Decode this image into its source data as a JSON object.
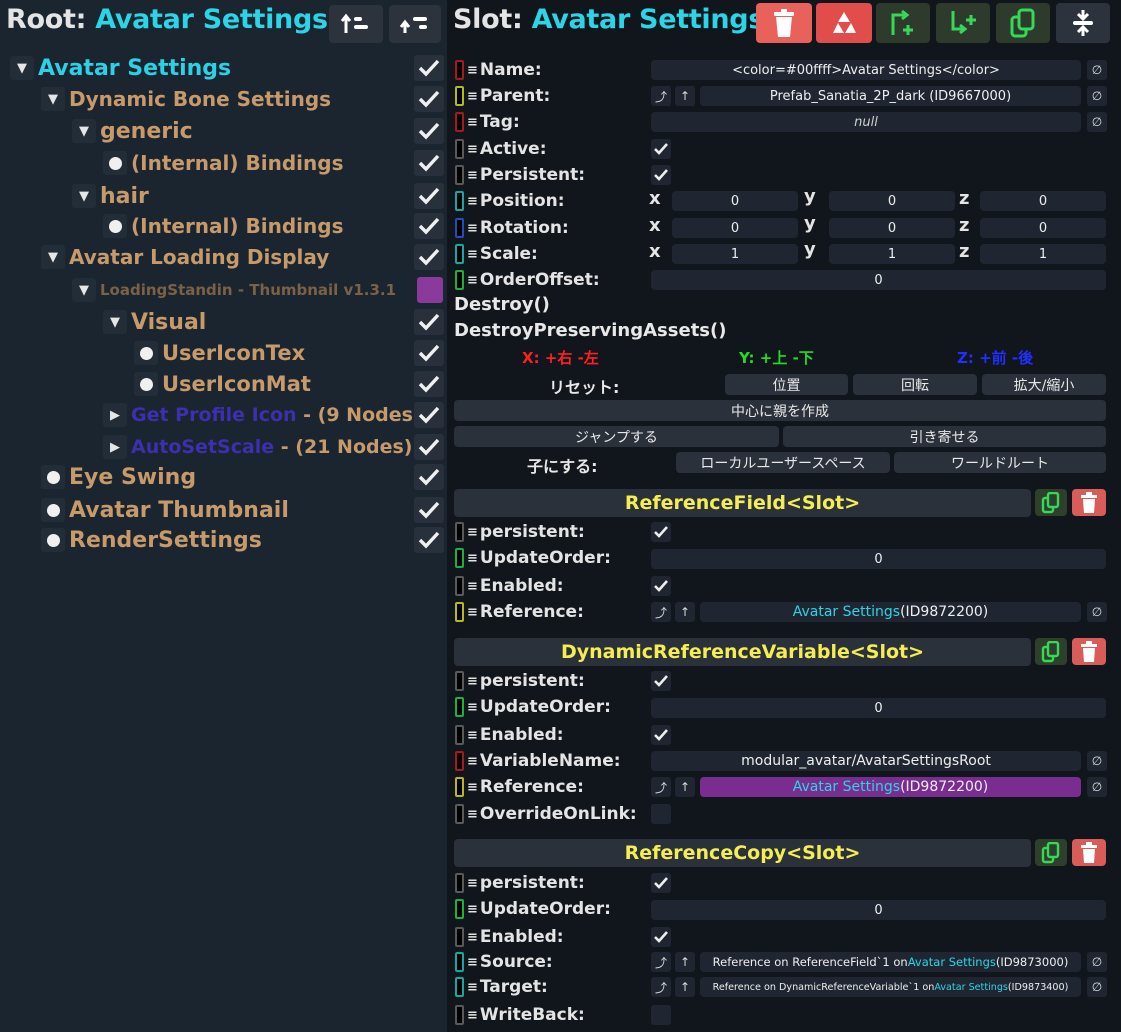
{
  "left": {
    "title_prefix": "Root: ",
    "title_name": "Avatar Settings",
    "tree": [
      {
        "label": "Avatar Settings",
        "color": "#2ed0e6",
        "marker": "tri"
      },
      {
        "label": "Dynamic Bone Settings",
        "color": "#c69a6b",
        "marker": "tri"
      },
      {
        "label": "generic",
        "color": "#c69a6b",
        "marker": "tri"
      },
      {
        "label": "(Internal) Bindings",
        "color": "#c69a6b",
        "marker": "dot"
      },
      {
        "label": "hair",
        "color": "#c69a6b",
        "marker": "tri"
      },
      {
        "label": "(Internal) Bindings",
        "color": "#c69a6b",
        "marker": "dot"
      },
      {
        "label": "Avatar Loading Display",
        "color": "#c69a6b",
        "marker": "tri"
      },
      {
        "label": "LoadingStandin - Thumbnail v1.3.1",
        "color": "#7a6148",
        "marker": "tri"
      },
      {
        "label": "Visual",
        "color": "#c69a6b",
        "marker": "tri"
      },
      {
        "label": "UserIconTex",
        "color": "#c69a6b",
        "marker": "dot"
      },
      {
        "label": "UserIconMat",
        "color": "#c69a6b",
        "marker": "dot"
      },
      {
        "label": "Get Profile Icon",
        "suffix": " - (9 Nodes)",
        "color": "#3d2fae",
        "marker": "tri-right"
      },
      {
        "label": "AutoSetScale",
        "suffix": " - (21 Nodes)",
        "color": "#3d2fae",
        "marker": "tri-right"
      },
      {
        "label": "Eye Swing",
        "color": "#c69a6b",
        "marker": "dot"
      },
      {
        "label": "Avatar Thumbnail",
        "color": "#c69a6b",
        "marker": "dot"
      },
      {
        "label": "RenderSettings",
        "color": "#c69a6b",
        "marker": "dot"
      }
    ]
  },
  "right": {
    "title_prefix": "Slot: ",
    "title_name": "Avatar Settings",
    "slot": {
      "name_label": "Name:",
      "name_value": "<color=#00ffff>Avatar Settings</color>",
      "parent_label": "Parent:",
      "parent_value": "Prefab_Sanatia_2P_dark (ID9667000)",
      "tag_label": "Tag:",
      "tag_value": "null",
      "active_label": "Active:",
      "persistent_label": "Persistent:",
      "position_label": "Position:",
      "rotation_label": "Rotation:",
      "scale_label": "Scale:",
      "orderoffset_label": "OrderOffset:",
      "orderoffset_value": "0",
      "axis_x": "x",
      "axis_y": "y",
      "axis_z": "z",
      "position": [
        "0",
        "0",
        "0"
      ],
      "rotation": [
        "0",
        "0",
        "0"
      ],
      "scale": [
        "1",
        "1",
        "1"
      ]
    },
    "destroy_label": "Destroy()",
    "destroy_preserving_label": "DestroyPreservingAssets()",
    "axis_legend": {
      "x": "X: +右 -左",
      "y": "Y: +上 -下",
      "z": "Z: +前 -後"
    },
    "reset_label": "リセット:",
    "reset_buttons": [
      "位置",
      "回転",
      "拡大/縮小"
    ],
    "create_parent_label": "中心に親を作成",
    "jump_label": "ジャンプする",
    "pull_label": "引き寄せる",
    "child_label": "子にする:",
    "child_buttons": [
      "ローカルユーザースペース",
      "ワールドルート"
    ],
    "components": [
      {
        "title": "ReferenceField<Slot>",
        "persistent_label": "persistent:",
        "updateorder_label": "UpdateOrder:",
        "updateorder_value": "0",
        "enabled_label": "Enabled:",
        "reference_label": "Reference:",
        "reference_name": "Avatar Settings",
        "reference_id": " (ID9872200)"
      },
      {
        "title": "DynamicReferenceVariable<Slot>",
        "persistent_label": "persistent:",
        "updateorder_label": "UpdateOrder:",
        "updateorder_value": "0",
        "enabled_label": "Enabled:",
        "variablename_label": "VariableName:",
        "variablename_value": "modular_avatar/AvatarSettingsRoot",
        "reference_label": "Reference:",
        "reference_name": "Avatar Settings",
        "reference_id": " (ID9872200)",
        "override_label": "OverrideOnLink:"
      },
      {
        "title": "ReferenceCopy<Slot>",
        "persistent_label": "persistent:",
        "updateorder_label": "UpdateOrder:",
        "updateorder_value": "0",
        "enabled_label": "Enabled:",
        "source_label": "Source:",
        "source_pre": "Reference on ReferenceField`1 on ",
        "source_name": "Avatar Settings",
        "source_id": " (ID9873000)",
        "target_label": "Target:",
        "target_pre": "Reference on DynamicReferenceVariable`1 on ",
        "target_name": "Avatar Settings",
        "target_id": " (ID9873400)",
        "writeback_label": "WriteBack:"
      }
    ]
  },
  "colors": {
    "cyan": "#2bd5e6",
    "orange": "#c69a6b",
    "yellow": "#f5ee52",
    "purple_field": "#7a2d91",
    "red_button": "#e8615a",
    "green_icon": "#35d957",
    "axis_x": "#ff2020",
    "axis_y": "#22dd22",
    "axis_z": "#2030ff"
  }
}
